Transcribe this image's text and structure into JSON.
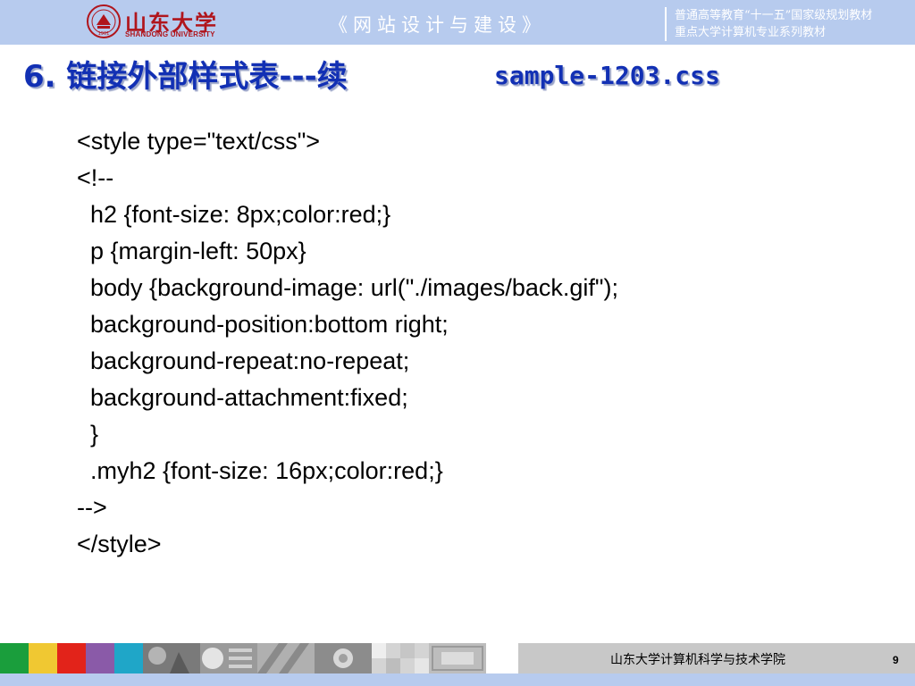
{
  "header": {
    "logo": {
      "name": "山东大学",
      "subtitle": "SHANDONG UNIVERSITY",
      "seal_year": "1901"
    },
    "course_title": "《网站设计与建设》",
    "series_line_1": "普通高等教育“十一五”国家级规划教材",
    "series_line_2": "重点大学计算机专业系列教材"
  },
  "slide": {
    "title": "6. 链接外部样式表---续",
    "title_file": "sample-1203.css",
    "code_lines": [
      "<style type=\"text/css\">",
      "<!--",
      "  h2 {font-size: 8px;color:red;}",
      "  p {margin-left: 50px}",
      "  body {background-image: url(\"./images/back.gif\");",
      "  background-position:bottom right;",
      "  background-repeat:no-repeat;",
      "  background-attachment:fixed;",
      "  }",
      "  .myh2 {font-size: 16px;color:red;}",
      "-->",
      "</style>"
    ]
  },
  "footer": {
    "school": "山东大学计算机科学与技术学院",
    "page_number": "9",
    "swatch_colors": [
      "#1a9e3c",
      "#f0c832",
      "#e2231a",
      "#8a5aa8",
      "#1fa6c8"
    ]
  },
  "colors": {
    "header_band": "#b7cbee",
    "title_blue": "#1230b4",
    "logo_red": "#b0151c",
    "footer_gray": "#c8c8c8"
  }
}
